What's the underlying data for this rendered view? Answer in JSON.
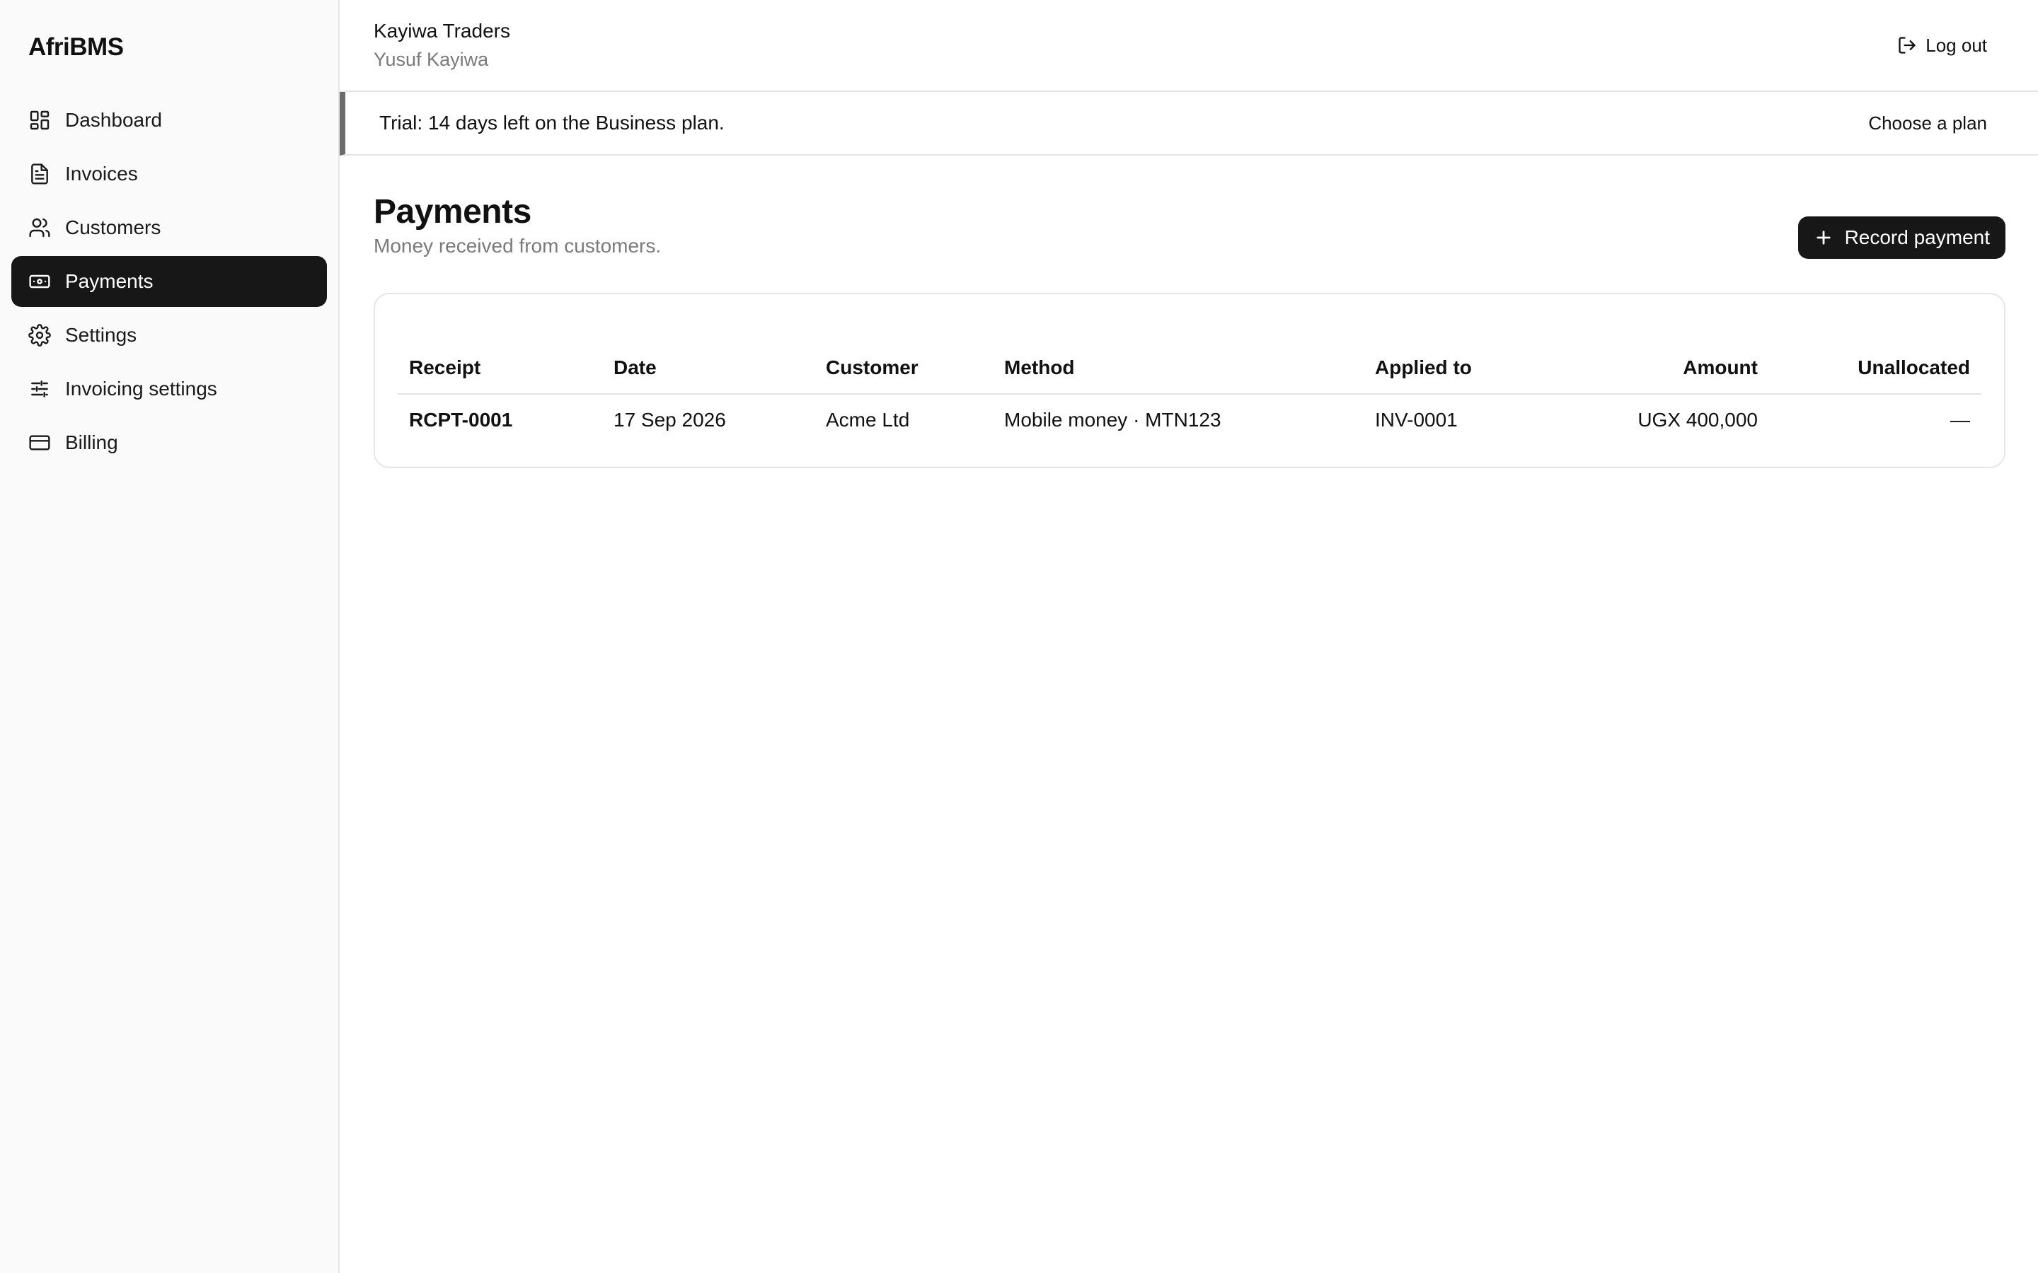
{
  "brand": "AfriBMS",
  "sidebar": {
    "items": [
      {
        "label": "Dashboard",
        "icon": "dashboard-icon"
      },
      {
        "label": "Invoices",
        "icon": "file-icon"
      },
      {
        "label": "Customers",
        "icon": "users-icon"
      },
      {
        "label": "Payments",
        "icon": "banknote-icon",
        "active": true
      },
      {
        "label": "Settings",
        "icon": "gear-icon"
      },
      {
        "label": "Invoicing settings",
        "icon": "sliders-icon"
      },
      {
        "label": "Billing",
        "icon": "credit-card-icon"
      }
    ]
  },
  "header": {
    "org_name": "Kayiwa Traders",
    "user_name": "Yusuf Kayiwa",
    "logout_label": "Log out"
  },
  "trial_banner": {
    "text": "Trial: 14 days left on the Business plan.",
    "action_label": "Choose a plan"
  },
  "page": {
    "title": "Payments",
    "subtitle": "Money received from customers.",
    "primary_action": "Record payment"
  },
  "table": {
    "columns": [
      "Receipt",
      "Date",
      "Customer",
      "Method",
      "Applied to",
      "Amount",
      "Unallocated"
    ],
    "rows": [
      {
        "receipt": "RCPT-0001",
        "date": "17 Sep 2026",
        "customer": "Acme Ltd",
        "method": "Mobile money · MTN123",
        "applied_to": "INV-0001",
        "amount": "UGX 400,000",
        "unallocated": "—"
      }
    ]
  },
  "colors": {
    "accent": "#171717",
    "sidebar_bg": "#fafafa",
    "border": "#e6e6e6",
    "muted_text": "#7a7a7a"
  }
}
